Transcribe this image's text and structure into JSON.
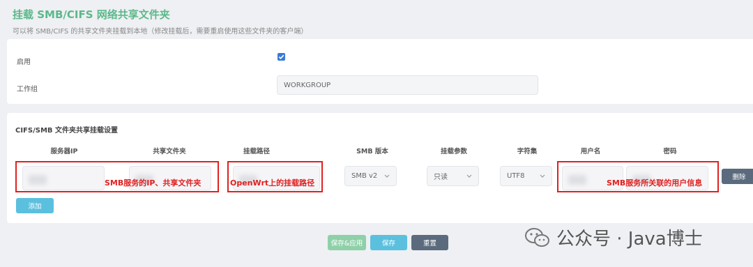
{
  "page": {
    "title": "挂载 SMB/CIFS 网络共享文件夹",
    "description": "可以将 SMB/CIFS 的共享文件夹挂载到本地（修改挂载后，需要重启使用这些文件夹的客户端）"
  },
  "general": {
    "enable_label": "启用",
    "enable_checked": true,
    "workgroup_label": "工作组",
    "workgroup_value": "WORKGROUP"
  },
  "mounts": {
    "section_title": "CIFS/SMB 文件夹共享挂载设置",
    "columns": [
      "服务器IP",
      "共享文件夹",
      "挂载路径",
      "SMB 版本",
      "挂载参数",
      "字符集",
      "用户名",
      "密码"
    ],
    "row": {
      "smb_version": "SMB v2",
      "mount_options": "只读",
      "charset": "UTF8",
      "delete_label": "删除"
    },
    "add_label": "添加"
  },
  "annotations": {
    "server_share": "SMB服务的IP、共享文件夹",
    "mount_path": "OpenWrt上的挂载路径",
    "credentials": "SMB服务所关联的用户信息"
  },
  "footer": {
    "save_apply_label": "保存&应用",
    "save_label": "保存",
    "reset_label": "重置"
  },
  "watermark": {
    "text": "公众号 · Java博士"
  },
  "colors": {
    "title_green": "#5cb88a",
    "checkbox_blue": "#3a7bd5",
    "annotation_red": "#e02020",
    "button_green": "#8fd0a9",
    "button_blue": "#5bc0de",
    "button_gray": "#5b6b7d"
  }
}
